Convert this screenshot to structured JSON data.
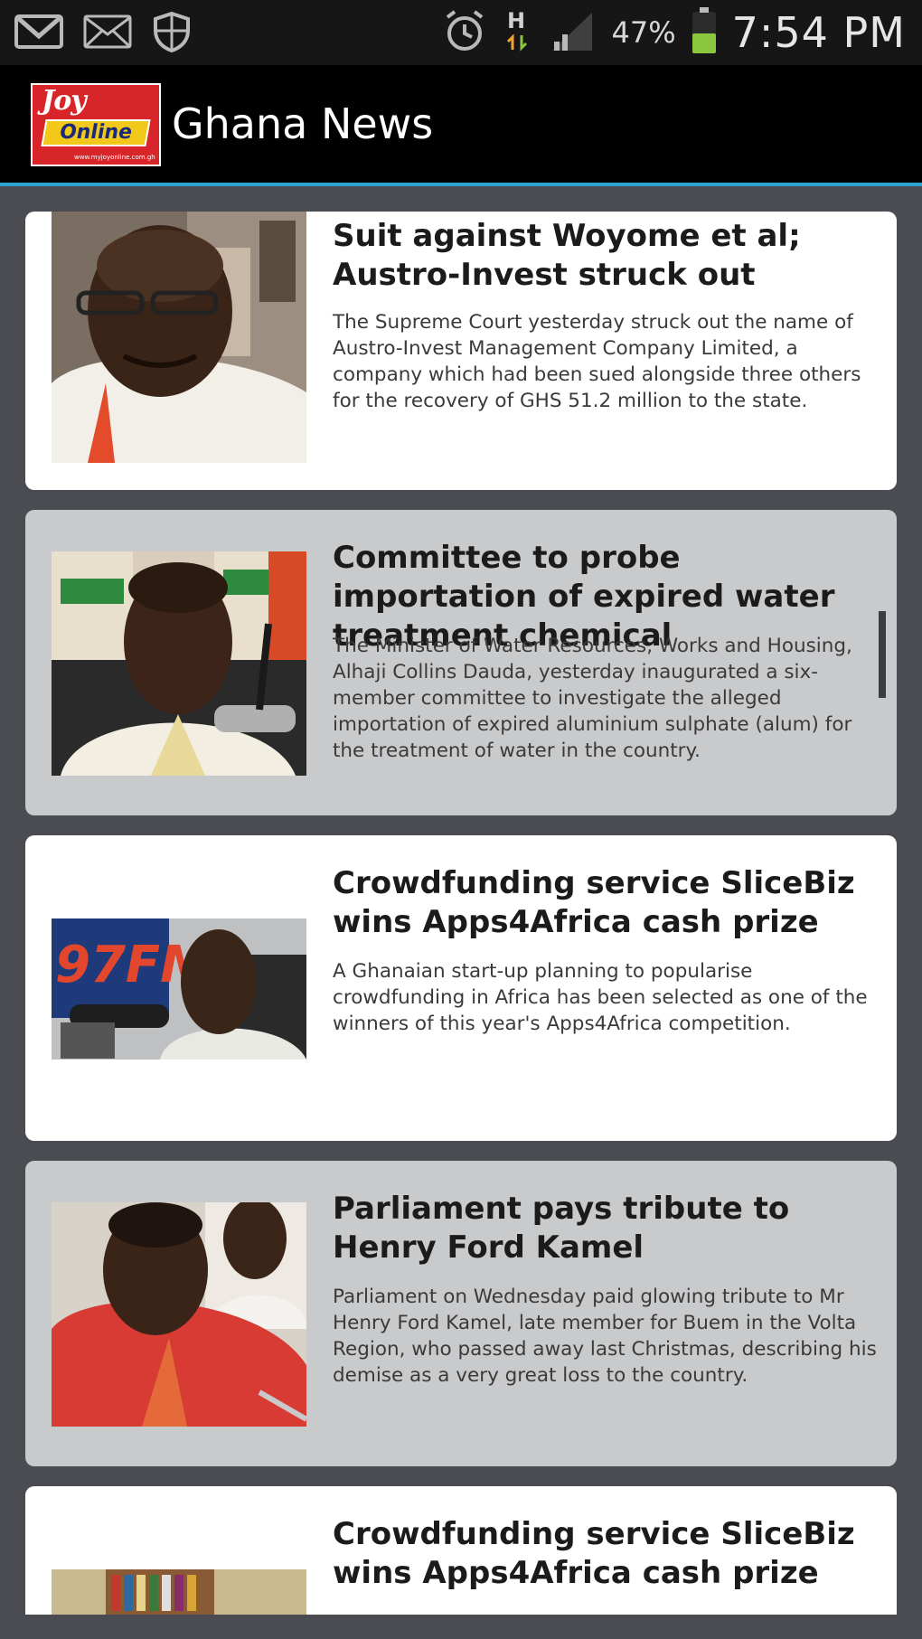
{
  "status_bar": {
    "icons_left": [
      "gmail-icon",
      "mail-icon",
      "shield-icon"
    ],
    "icons_right": [
      "alarm-icon",
      "hplus-data-icon",
      "signal-icon"
    ],
    "battery_percent": "47%",
    "battery_level": 0.47,
    "time": "7:54 PM"
  },
  "action_bar": {
    "logo_line1": "Joy",
    "logo_line2": "Online",
    "logo_url": "www.myjoyonline.com.gh",
    "title": "Ghana News"
  },
  "articles": [
    {
      "title": "Suit against Woyome et al; Austro-Invest struck out",
      "summary": "The Supreme Court yesterday struck out the name of Austro-Invest Management Company Limited, a company which had been sued alongside three others for the recovery of GHS 51.2 million to the state."
    },
    {
      "title": "Committee to probe importation of expired water treatment chemical",
      "summary": "The Minister of Water Resources, Works and Housing, Alhaji Collins Dauda, yesterday inaugurated a six-member committee to investigate the alleged importation of expired aluminium sulphate (alum) for the treatment of water in the country."
    },
    {
      "title": "Crowdfunding service SliceBiz wins Apps4Africa cash prize",
      "summary": "A Ghanaian start-up planning to popularise crowdfunding in Africa has been selected as one of the winners of this year's Apps4Africa competition."
    },
    {
      "title": "Parliament pays tribute to Henry Ford Kamel",
      "summary": "Parliament on Wednesday paid glowing tribute to Mr Henry Ford Kamel, late member for Buem in the Volta Region, who passed away last Christmas, describing his demise as a  very great loss  to the country."
    },
    {
      "title": "Crowdfunding service SliceBiz wins Apps4Africa cash prize",
      "summary": ""
    }
  ],
  "colors": {
    "accent": "#2ea2d2",
    "card_white": "#ffffff",
    "card_gray": "#c9cacc",
    "background": "#4a4c51"
  }
}
